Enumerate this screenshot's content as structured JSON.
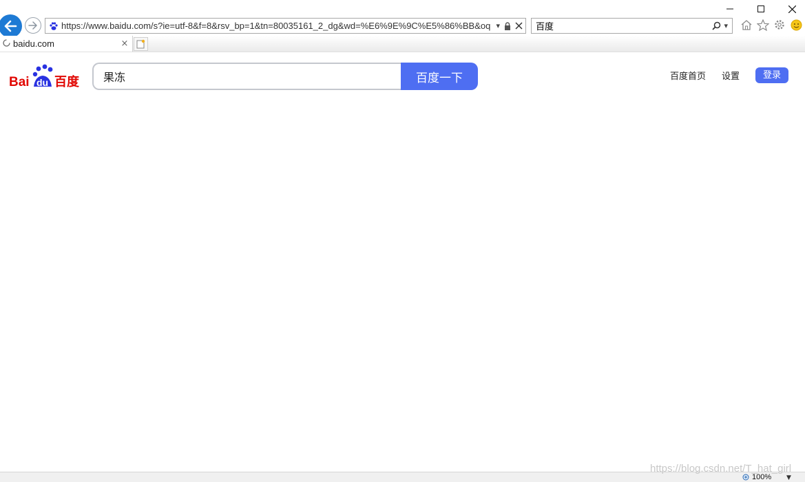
{
  "browser": {
    "url": "https://www.baidu.com/s?ie=utf-8&f=8&rsv_bp=1&tn=80035161_2_dg&wd=%E6%9E%9C%E5%86%BB&oq",
    "search_value": "百度",
    "tab_title": "baidu.com",
    "tab_close_glyph": "×",
    "zoom_level": "100%"
  },
  "page": {
    "logo_text_bai": "Bai",
    "logo_text_du": "du",
    "logo_text_cn": "百度",
    "query": "果冻",
    "search_button": "百度一下",
    "links": {
      "home": "百度首页",
      "settings": "设置",
      "login": "登录"
    }
  },
  "watermark": "https://blog.csdn.net/T_hat_girl",
  "colors": {
    "accent": "#4e6ef2",
    "back_button": "#1e7ad4",
    "logo_red": "#e10601",
    "logo_blue": "#2932e1"
  }
}
